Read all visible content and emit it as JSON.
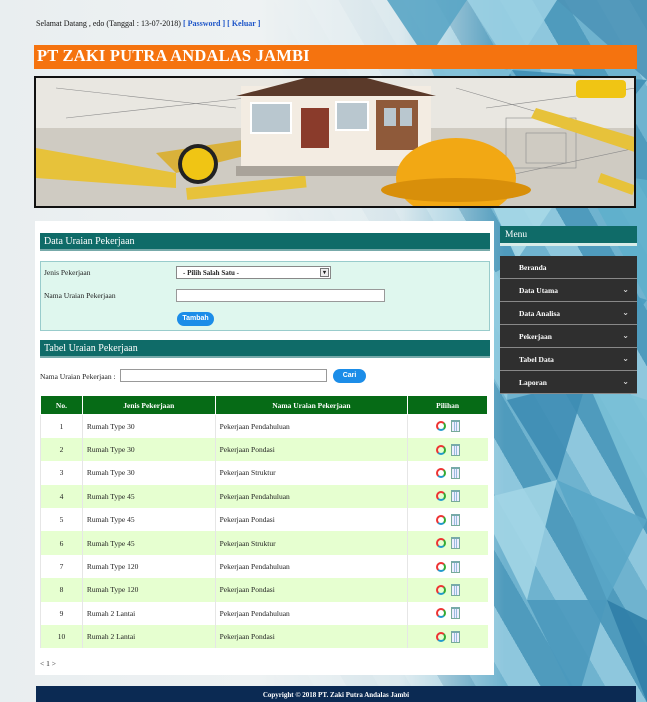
{
  "topbar": {
    "greeting": "Selamat Datang , edo (Tanggal : 13-07-2018)",
    "password_link": "[ Password ]",
    "logout_link": "[ Keluar ]"
  },
  "brand": {
    "title": "PT ZAKI PUTRA ANDALAS JAMBI"
  },
  "form_section": {
    "title": "Data Uraian Pekerjaan",
    "jenis_label": "Jenis Pekerjaan",
    "jenis_select_value": "- Pilih Salah Satu -",
    "nama_label": "Nama Uraian Pekerjaan",
    "nama_value": "",
    "add_button": "Tambah"
  },
  "table_section": {
    "title": "Tabel Uraian Pekerjaan",
    "search_label": "Nama Uraian Pekerjaan :",
    "search_value": "",
    "search_button": "Cari",
    "headers": [
      "No.",
      "Jenis Pekerjaan",
      "Nama Uraian Pekerjaan",
      "Pilihan"
    ],
    "rows": [
      {
        "no": "1",
        "jenis": "Rumah Type 30",
        "nama": "Pekerjaan Pendahuluan"
      },
      {
        "no": "2",
        "jenis": "Rumah Type 30",
        "nama": "Pekerjaan Pondasi"
      },
      {
        "no": "3",
        "jenis": "Rumah Type 30",
        "nama": "Pekerjaan Struktur"
      },
      {
        "no": "4",
        "jenis": "Rumah Type 45",
        "nama": "Pekerjaan Pendahuluan"
      },
      {
        "no": "5",
        "jenis": "Rumah Type 45",
        "nama": "Pekerjaan Pondasi"
      },
      {
        "no": "6",
        "jenis": "Rumah Type 45",
        "nama": "Pekerjaan Struktur"
      },
      {
        "no": "7",
        "jenis": "Rumah Type 120",
        "nama": "Pekerjaan Pendahuluan"
      },
      {
        "no": "8",
        "jenis": "Rumah Type 120",
        "nama": "Pekerjaan Pondasi"
      },
      {
        "no": "9",
        "jenis": "Rumah 2 Lantai",
        "nama": "Pekerjaan Pendahuluan"
      },
      {
        "no": "10",
        "jenis": "Rumah 2 Lantai",
        "nama": "Pekerjaan Pondasi"
      }
    ],
    "pager": "< 1 >"
  },
  "menu": {
    "title": "Menu",
    "items": [
      {
        "label": "Beranda",
        "has_sub": false
      },
      {
        "label": "Data Utama",
        "has_sub": true
      },
      {
        "label": "Data Analisa",
        "has_sub": true
      },
      {
        "label": "Pekerjaan",
        "has_sub": true
      },
      {
        "label": "Tabel Data",
        "has_sub": true
      },
      {
        "label": "Laporan",
        "has_sub": true
      }
    ]
  },
  "footer": {
    "text": "Copyright © 2018 PT. Zaki Putra Andalas Jambi"
  },
  "colors": {
    "brand_bar": "#f5730f",
    "section_head": "#0f6b68",
    "table_head": "#066b16",
    "row_alt": "#e6ffd0",
    "button": "#1c8de8",
    "footer": "#0b2a53"
  },
  "icons": {
    "edit": "edit-circle-icon",
    "delete": "trash-icon",
    "menu_chevron": "chevron-down-icon"
  }
}
